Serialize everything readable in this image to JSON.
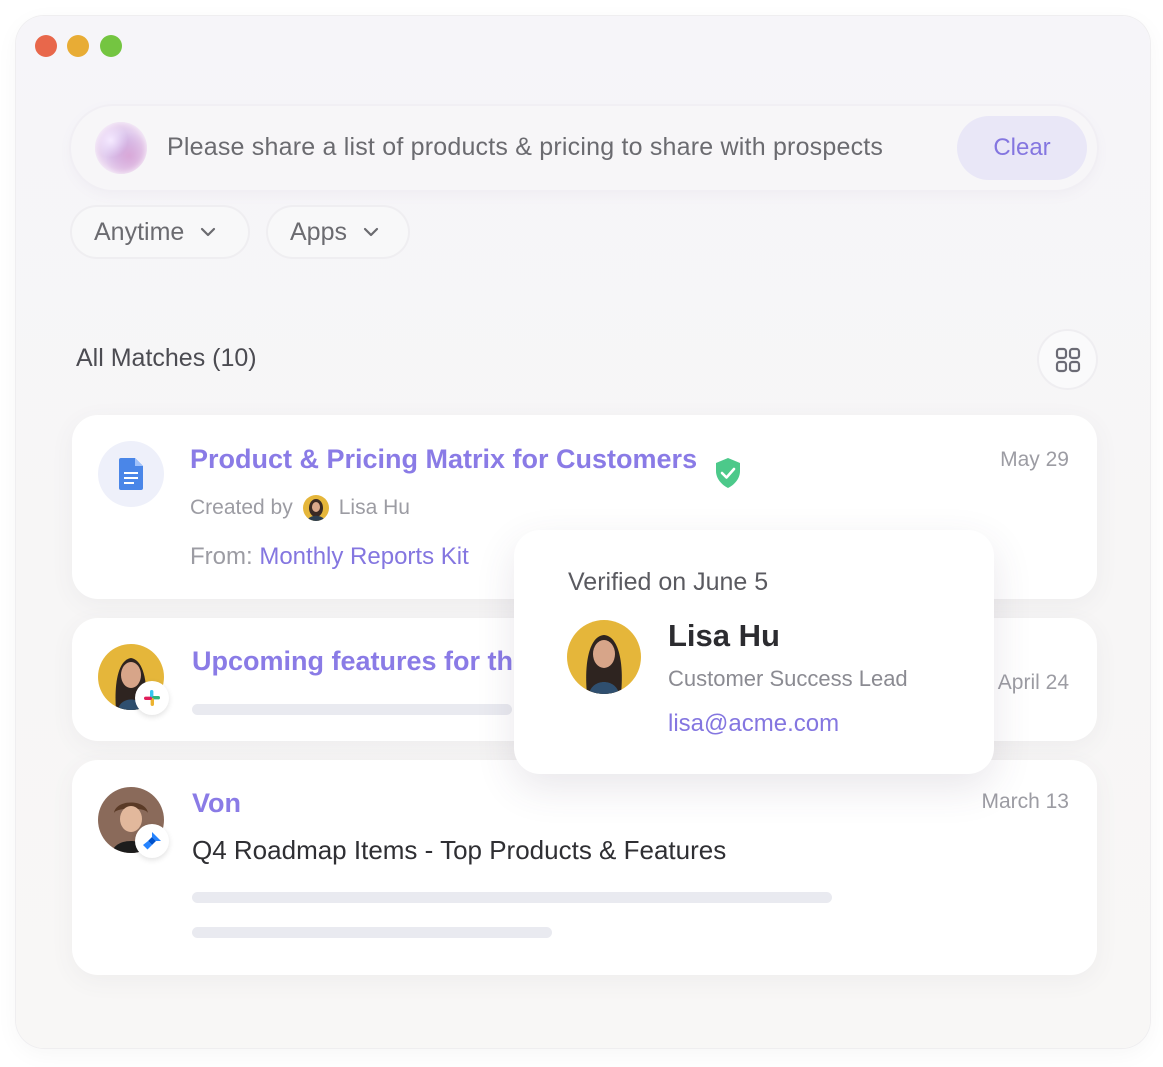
{
  "search": {
    "query": "Please share a list of products & pricing to share with prospects",
    "clear_label": "Clear"
  },
  "filters": {
    "anytime_label": "Anytime",
    "apps_label": "Apps"
  },
  "matches": {
    "title": "All Matches (10)"
  },
  "results": [
    {
      "title": "Product & Pricing Matrix for Customers",
      "date": "May 29",
      "created_by_label": "Created by",
      "author": "Lisa Hu",
      "from_label": "From:",
      "from_link": "Monthly Reports Kit",
      "icon": "google-docs-icon",
      "verified": true
    },
    {
      "title": "Upcoming features for th",
      "date": "April 24",
      "source_icon": "slack-icon"
    },
    {
      "title": "Von",
      "subtitle": "Q4 Roadmap Items - Top Products & Features",
      "date": "March 13",
      "source_icon": "jira-icon"
    }
  ],
  "popover": {
    "verified_text": "Verified on June 5",
    "name": "Lisa Hu",
    "role": "Customer Success Lead",
    "email": "lisa@acme.com"
  },
  "colors": {
    "accent": "#8476e0",
    "verified_green": "#4cc98a",
    "traffic_red": "#e8674b",
    "traffic_yellow": "#e8ac35",
    "traffic_green": "#74c541"
  }
}
